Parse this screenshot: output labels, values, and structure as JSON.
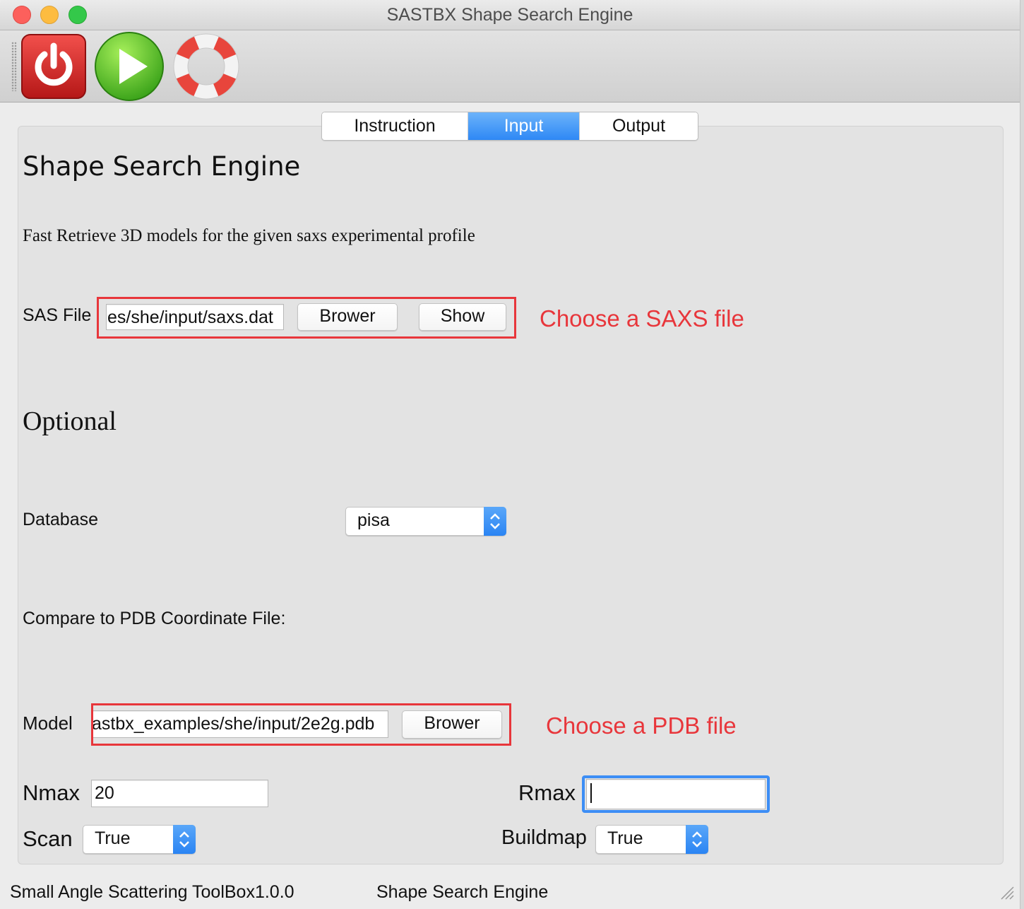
{
  "window": {
    "title": "SASTBX Shape Search Engine"
  },
  "toolbar": {
    "buttons": [
      "power-icon",
      "play-icon",
      "lifebuoy-icon"
    ]
  },
  "tabs": [
    {
      "label": "Instruction",
      "selected": false
    },
    {
      "label": "Input",
      "selected": true
    },
    {
      "label": "Output",
      "selected": false
    }
  ],
  "main": {
    "heading": "Shape Search Engine",
    "description": "Fast Retrieve 3D models for the given saxs experimental profile",
    "sas_file": {
      "label": "SAS File",
      "value": "es/she/input/saxs.dat",
      "browse_label": "Brower",
      "show_label": "Show"
    },
    "sas_note": "Choose a SAXS file",
    "optional_heading": "Optional",
    "database": {
      "label": "Database",
      "selected": "pisa"
    },
    "compare_label": "Compare to PDB Coordinate File:",
    "model": {
      "label": "Model",
      "value": "astbx_examples/she/input/2e2g.pdb",
      "browse_label": "Brower"
    },
    "model_note": "Choose a PDB file",
    "nmax": {
      "label": "Nmax",
      "value": "20"
    },
    "rmax": {
      "label": "Rmax",
      "value": ""
    },
    "scan": {
      "label": "Scan",
      "selected": "True"
    },
    "buildmap": {
      "label": "Buildmap",
      "selected": "True"
    }
  },
  "statusbar": {
    "left": "Small Angle Scattering ToolBox1.0.0",
    "right": "Shape Search Engine"
  },
  "colors": {
    "accent": "#2e88f5",
    "annotation": "#e8363b"
  }
}
